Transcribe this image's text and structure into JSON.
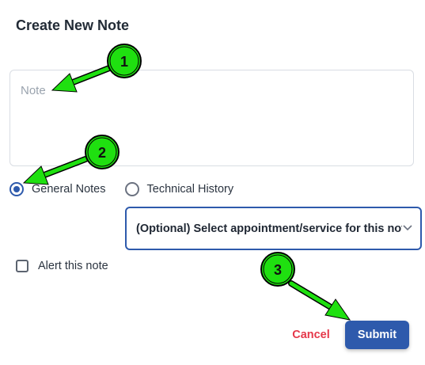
{
  "dialog": {
    "title": "Create New Note",
    "note_placeholder": "Note",
    "note_value": "",
    "radio_options": [
      {
        "label": "General Notes",
        "checked": true
      },
      {
        "label": "Technical History",
        "checked": false
      }
    ],
    "appointment_select": {
      "value": "(Optional) Select appointment/service for this note..."
    },
    "alert_checkbox": {
      "label": "Alert this note",
      "checked": false
    },
    "cancel_label": "Cancel",
    "submit_label": "Submit"
  },
  "annotations": {
    "markers": [
      "1",
      "2",
      "3"
    ],
    "marker_color": "#1fe010",
    "arrow_color": "#1fe010"
  },
  "colors": {
    "primary": "#2e5aac",
    "cancel": "#e5384a",
    "placeholder": "#9aa3ae"
  }
}
